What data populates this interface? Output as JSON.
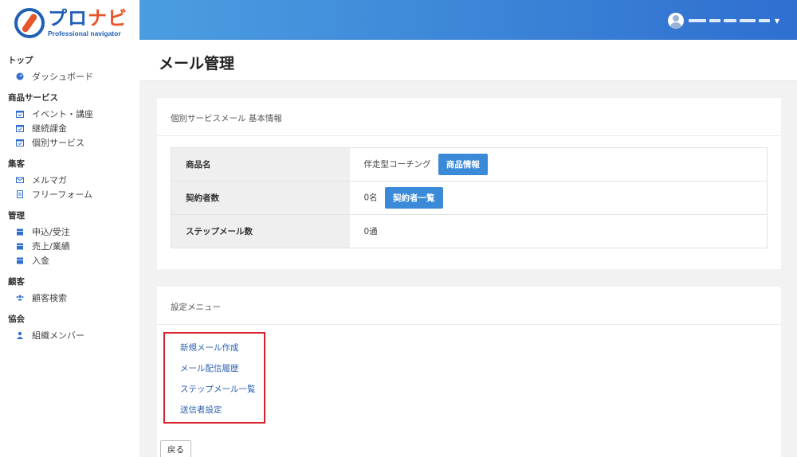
{
  "logo": {
    "main_pre": "プロ",
    "main_accent": "ナビ",
    "sub": "Professional navigator"
  },
  "sidebar": {
    "groups": [
      {
        "heading": "トップ",
        "items": [
          {
            "label": "ダッシュボード",
            "icon": "dashboard-icon"
          }
        ]
      },
      {
        "heading": "商品サービス",
        "items": [
          {
            "label": "イベント・講座",
            "icon": "calendar-check-icon"
          },
          {
            "label": "継続課金",
            "icon": "calendar-check-icon"
          },
          {
            "label": "個別サービス",
            "icon": "calendar-check-icon"
          }
        ]
      },
      {
        "heading": "集客",
        "items": [
          {
            "label": "メルマガ",
            "icon": "envelope-icon"
          },
          {
            "label": "フリーフォーム",
            "icon": "form-icon"
          }
        ]
      },
      {
        "heading": "管理",
        "items": [
          {
            "label": "申込/受注",
            "icon": "calendar-icon"
          },
          {
            "label": "売上/業績",
            "icon": "calendar-icon"
          },
          {
            "label": "入金",
            "icon": "calendar-icon"
          }
        ]
      },
      {
        "heading": "顧客",
        "items": [
          {
            "label": "顧客検索",
            "icon": "users-icon"
          }
        ]
      },
      {
        "heading": "協会",
        "items": [
          {
            "label": "組織メンバー",
            "icon": "user-icon"
          }
        ]
      }
    ]
  },
  "header": {
    "page_title": "メール管理"
  },
  "info_card": {
    "title": "個別サービスメール 基本情報",
    "rows": {
      "product": {
        "label": "商品名",
        "value": "伴走型コーチング",
        "button": "商品情報"
      },
      "contracts": {
        "label": "契約者数",
        "value": "0名",
        "button": "契約者一覧"
      },
      "steps": {
        "label": "ステップメール数",
        "value": "0通"
      }
    }
  },
  "settings_card": {
    "title": "設定メニュー",
    "links": {
      "new_mail": "新規メール作成",
      "history": "メール配信履歴",
      "step_list": "ステップメール一覧",
      "sender": "送信者設定"
    }
  },
  "footer": {
    "back_label": "戻る"
  },
  "colors": {
    "topbar_start": "#4b9de0",
    "topbar_end": "#2f6fd0",
    "button": "#3a8ad8",
    "highlight": "#d8202a",
    "link": "#2a5fb0",
    "nav_icon": "#2f6fd0"
  }
}
